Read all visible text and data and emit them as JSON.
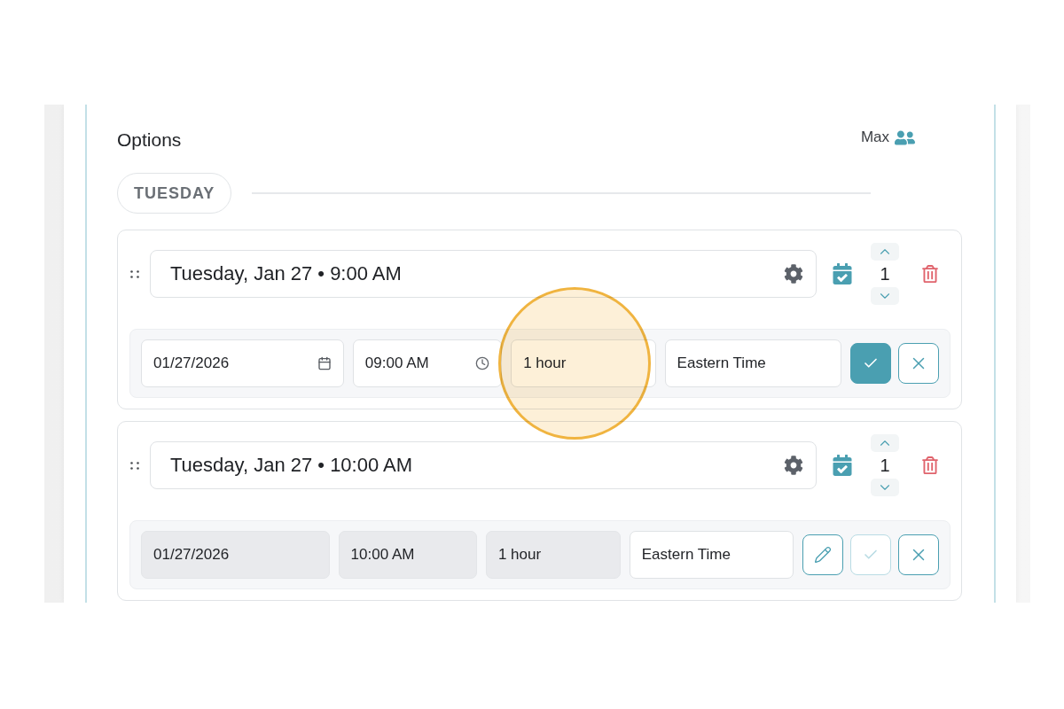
{
  "section": {
    "title": "Options",
    "max_label": "Max"
  },
  "day_groups": [
    {
      "label": "TUESDAY",
      "options": [
        {
          "title": "Tuesday, Jan 27 • 9:00 AM",
          "count": "1",
          "fields": [
            {
              "kind": "date",
              "value": "01/27/2026",
              "disabled": false,
              "highlighted": false
            },
            {
              "kind": "time",
              "value": "09:00 AM",
              "disabled": false,
              "highlighted": false
            },
            {
              "kind": "duration",
              "value": "1 hour",
              "disabled": false,
              "highlighted": true
            },
            {
              "kind": "timezone",
              "value": "Eastern Time",
              "disabled": false,
              "highlighted": false
            }
          ],
          "buttons": [
            {
              "kind": "confirm",
              "disabled": false
            },
            {
              "kind": "cancel",
              "disabled": false
            }
          ]
        },
        {
          "title": "Tuesday, Jan 27 • 10:00 AM",
          "count": "1",
          "fields": [
            {
              "kind": "date",
              "value": "01/27/2026",
              "disabled": true,
              "highlighted": false
            },
            {
              "kind": "time",
              "value": "10:00 AM",
              "disabled": true,
              "highlighted": false
            },
            {
              "kind": "duration",
              "value": "1 hour",
              "disabled": true,
              "highlighted": false
            },
            {
              "kind": "timezone",
              "value": "Eastern Time",
              "disabled": false,
              "highlighted": false
            }
          ],
          "buttons": [
            {
              "kind": "edit",
              "disabled": false
            },
            {
              "kind": "confirm",
              "disabled": true
            },
            {
              "kind": "cancel",
              "disabled": false
            }
          ]
        }
      ]
    }
  ]
}
